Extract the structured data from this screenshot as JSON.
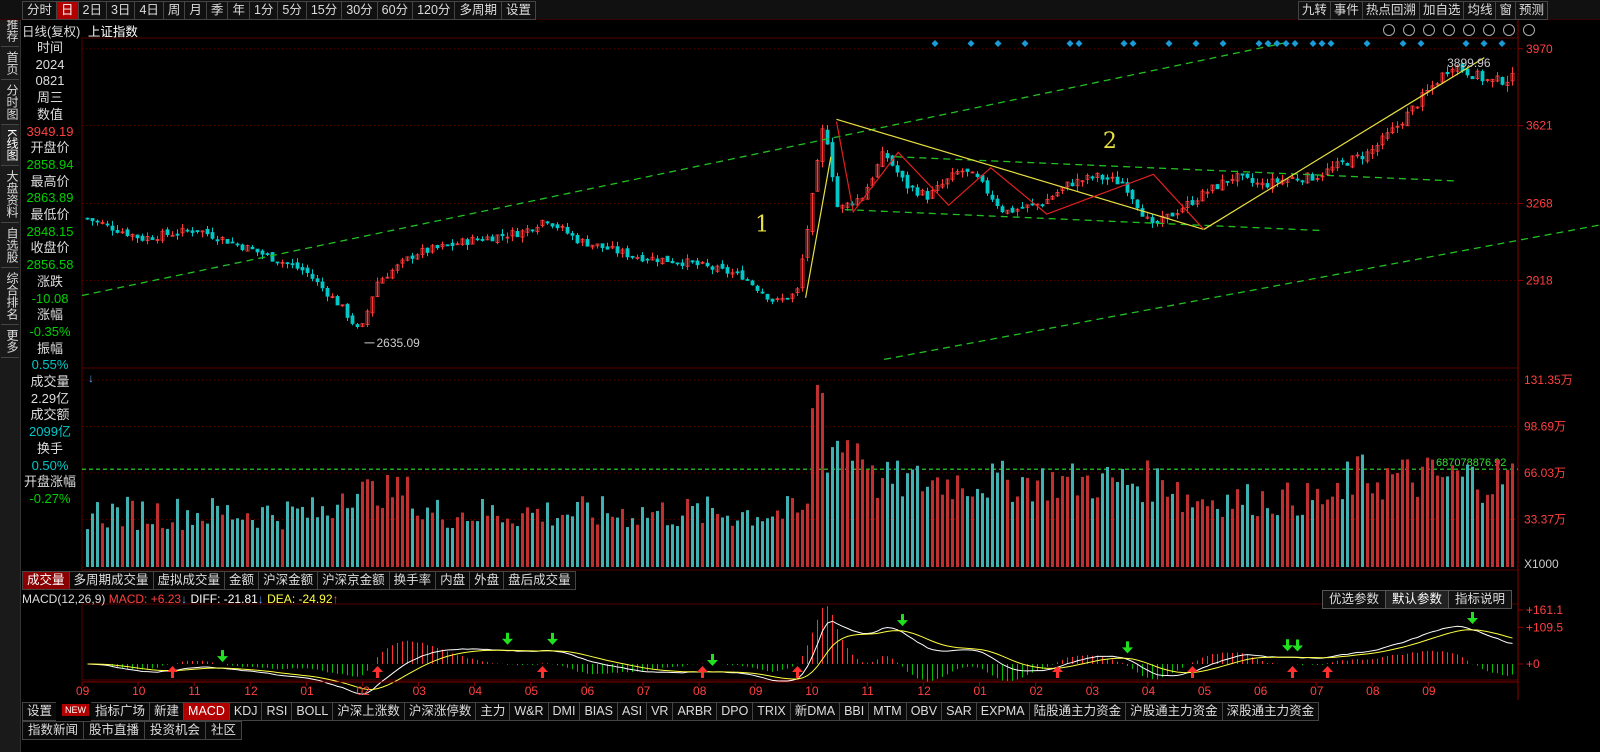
{
  "topbar": {
    "periods": [
      "分时",
      "日",
      "2日",
      "3日",
      "4日",
      "周",
      "月",
      "季",
      "年",
      "1分",
      "5分",
      "15分",
      "30分",
      "60分",
      "120分",
      "多周期",
      "设置"
    ],
    "active_period": "日",
    "right_items": [
      "九转",
      "事件",
      "热点回溯",
      "加自选",
      "均线",
      "窗",
      "预测"
    ]
  },
  "sidenav": {
    "items": [
      "推荐",
      "首页",
      "分时图",
      "K线图",
      "大盘资料",
      "自选股",
      "综合排名",
      "更多"
    ],
    "active": "K线图"
  },
  "title": {
    "mode": "日线(复权)",
    "symbol": "上证指数"
  },
  "info_panel": [
    {
      "label": "时间",
      "value": "2024",
      "cls": "white"
    },
    {
      "label": "",
      "value": "0821",
      "cls": "white"
    },
    {
      "label": "",
      "value": "周三",
      "cls": "white"
    },
    {
      "label": "数值",
      "value": "3949.19",
      "cls": "red"
    },
    {
      "label": "开盘价",
      "value": "2858.94",
      "cls": "green"
    },
    {
      "label": "最高价",
      "value": "2863.89",
      "cls": "green"
    },
    {
      "label": "最低价",
      "value": "2848.15",
      "cls": "green"
    },
    {
      "label": "收盘价",
      "value": "2856.58",
      "cls": "green"
    },
    {
      "label": "涨跌",
      "value": "-10.08",
      "cls": "green"
    },
    {
      "label": "涨幅",
      "value": "-0.35%",
      "cls": "green"
    },
    {
      "label": "振幅",
      "value": "0.55%",
      "cls": "cyan"
    },
    {
      "label": "成交量",
      "value": "2.29亿",
      "cls": "white"
    },
    {
      "label": "成交额",
      "value": "2099亿",
      "cls": "cyan"
    },
    {
      "label": "换手",
      "value": "0.50%",
      "cls": "cyan"
    },
    {
      "label": "开盘涨幅",
      "value": "-0.27%",
      "cls": "green"
    }
  ],
  "chart_data": [
    {
      "type": "candlestick",
      "name": "price",
      "y_axis_ticks": [
        3970,
        3621,
        3268,
        2918
      ],
      "ylim": [
        2530,
        4010
      ],
      "x_months": [
        "09",
        "10",
        "11",
        "12",
        "01",
        "02",
        "03",
        "04",
        "05",
        "06",
        "07",
        "08",
        "09",
        "10",
        "11",
        "12",
        "01",
        "02",
        "03",
        "04",
        "05",
        "06",
        "07",
        "08",
        "09"
      ],
      "annotations": [
        {
          "text": "2635.09",
          "kind": "low_label"
        },
        {
          "text": "3899.96",
          "kind": "high_label"
        },
        {
          "text": "1",
          "kind": "wave_label"
        },
        {
          "text": "2",
          "kind": "wave_label"
        }
      ],
      "anchor_points": [
        {
          "m": 0.0,
          "v": 3200
        },
        {
          "m": 1.0,
          "v": 3110
        },
        {
          "m": 2.0,
          "v": 3150
        },
        {
          "m": 3.0,
          "v": 3060
        },
        {
          "m": 4.0,
          "v": 2960
        },
        {
          "m": 4.65,
          "v": 2800
        },
        {
          "m": 5.0,
          "v": 2680
        },
        {
          "m": 5.3,
          "v": 2910
        },
        {
          "m": 6.0,
          "v": 3040
        },
        {
          "m": 7.0,
          "v": 3100
        },
        {
          "m": 8.0,
          "v": 3140
        },
        {
          "m": 8.4,
          "v": 3200
        },
        {
          "m": 9.0,
          "v": 3100
        },
        {
          "m": 10.0,
          "v": 3030
        },
        {
          "m": 11.0,
          "v": 3000
        },
        {
          "m": 12.0,
          "v": 2940
        },
        {
          "m": 12.6,
          "v": 2820
        },
        {
          "m": 13.0,
          "v": 2860
        },
        {
          "m": 13.3,
          "v": 3320
        },
        {
          "m": 13.5,
          "v": 3650
        },
        {
          "m": 13.75,
          "v": 3240
        },
        {
          "m": 14.2,
          "v": 3300
        },
        {
          "m": 14.6,
          "v": 3500
        },
        {
          "m": 15.0,
          "v": 3350
        },
        {
          "m": 15.4,
          "v": 3300
        },
        {
          "m": 16.0,
          "v": 3420
        },
        {
          "m": 16.3,
          "v": 3380
        },
        {
          "m": 16.8,
          "v": 3230
        },
        {
          "m": 17.0,
          "v": 3240
        },
        {
          "m": 17.5,
          "v": 3270
        },
        {
          "m": 18.0,
          "v": 3360
        },
        {
          "m": 18.5,
          "v": 3390
        },
        {
          "m": 19.0,
          "v": 3360
        },
        {
          "m": 19.2,
          "v": 3280
        },
        {
          "m": 19.5,
          "v": 3160
        },
        {
          "m": 20.0,
          "v": 3240
        },
        {
          "m": 20.5,
          "v": 3320
        },
        {
          "m": 21.0,
          "v": 3390
        },
        {
          "m": 21.5,
          "v": 3350
        },
        {
          "m": 22.0,
          "v": 3380
        },
        {
          "m": 22.5,
          "v": 3390
        },
        {
          "m": 23.0,
          "v": 3450
        },
        {
          "m": 23.5,
          "v": 3500
        },
        {
          "m": 24.0,
          "v": 3620
        },
        {
          "m": 24.5,
          "v": 3760
        },
        {
          "m": 25.0,
          "v": 3900
        },
        {
          "m": 25.7,
          "v": 3820
        },
        {
          "m": 26.2,
          "v": 3840
        }
      ]
    },
    {
      "type": "bar",
      "name": "volume",
      "y_axis_ticks": [
        "131.35万",
        "98.69万",
        "66.03万",
        "33.37万"
      ],
      "unit_label": "X1000",
      "reference_label": "687078876.92"
    },
    {
      "type": "line",
      "name": "MACD",
      "legend": {
        "title": "MACD(12,26,9)",
        "macd": "MACD: +6.23",
        "diff": "DIFF: -21.81",
        "dea": "DEA: -24.92"
      },
      "y_axis_ticks": [
        "+161.1",
        "+109.5",
        "+0"
      ]
    }
  ],
  "indicator_tabs": [
    "成交量",
    "多周期成交量",
    "虚拟成交量",
    "金额",
    "沪深金额",
    "沪深京金额",
    "换手率",
    "内盘",
    "外盘",
    "盘后成交量"
  ],
  "active_indicator": "成交量",
  "macd_buttons": [
    "优选参数",
    "默认参数",
    "指标说明"
  ],
  "bottom_tabs": [
    "设置",
    "NEW",
    "指标广场",
    "新建",
    "MACD",
    "KDJ",
    "RSI",
    "BOLL",
    "沪深上涨数",
    "沪深涨停数",
    "主力",
    "W&R",
    "DMI",
    "BIAS",
    "ASI",
    "VR",
    "ARBR",
    "DPO",
    "TRIX",
    "新DMA",
    "BBI",
    "MTM",
    "OBV",
    "SAR",
    "EXPMA",
    "陆股通主力资金",
    "沪股通主力资金",
    "深股通主力资金"
  ],
  "active_bottom": "MACD",
  "news_tabs": [
    "指数新闻",
    "股市直播",
    "投资机会",
    "社区"
  ],
  "colors": {
    "up": "#ff3c3c",
    "down": "#00c8c8",
    "green_down": "#00d000",
    "grid": "#5a0000",
    "trend": "#20c020",
    "wave": "#e8e040",
    "zig": "#e02020"
  }
}
